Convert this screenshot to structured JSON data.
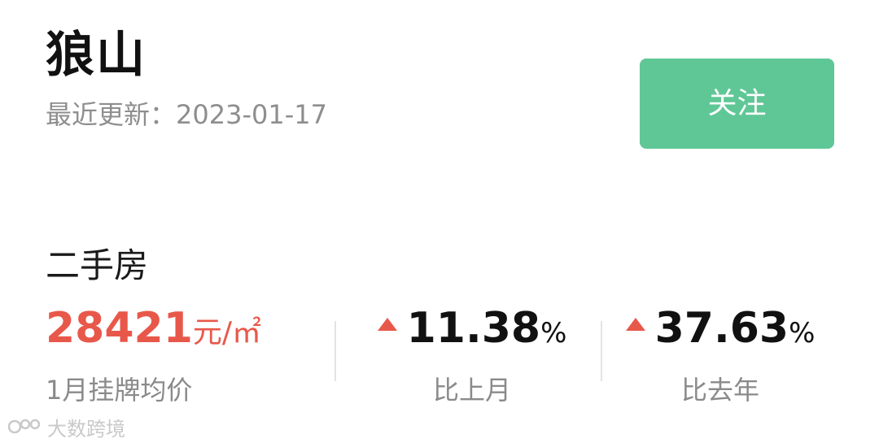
{
  "header": {
    "title": "狼山",
    "updated": "最近更新：2023-01-17",
    "follow_label": "关注"
  },
  "section": {
    "title": "二手房"
  },
  "stats": {
    "price": {
      "value": "28421",
      "unit": "元/㎡",
      "label": "1月挂牌均价"
    },
    "month_on_month": {
      "value": "11.38",
      "sign": "%",
      "label": "比上月",
      "trend": "up"
    },
    "year_on_year": {
      "value": "37.63",
      "sign": "%",
      "label": "比去年",
      "trend": "up"
    }
  },
  "watermark": {
    "text": "大数跨境"
  },
  "colors": {
    "accent_green": "#5fc796",
    "price_red": "#e8584a",
    "arrow_up": "#e8584a",
    "muted_gray": "#8e8e8e"
  },
  "icons": {
    "trend_up": "triangle-up-icon",
    "watermark_logo": "watermark-logo-icon"
  }
}
